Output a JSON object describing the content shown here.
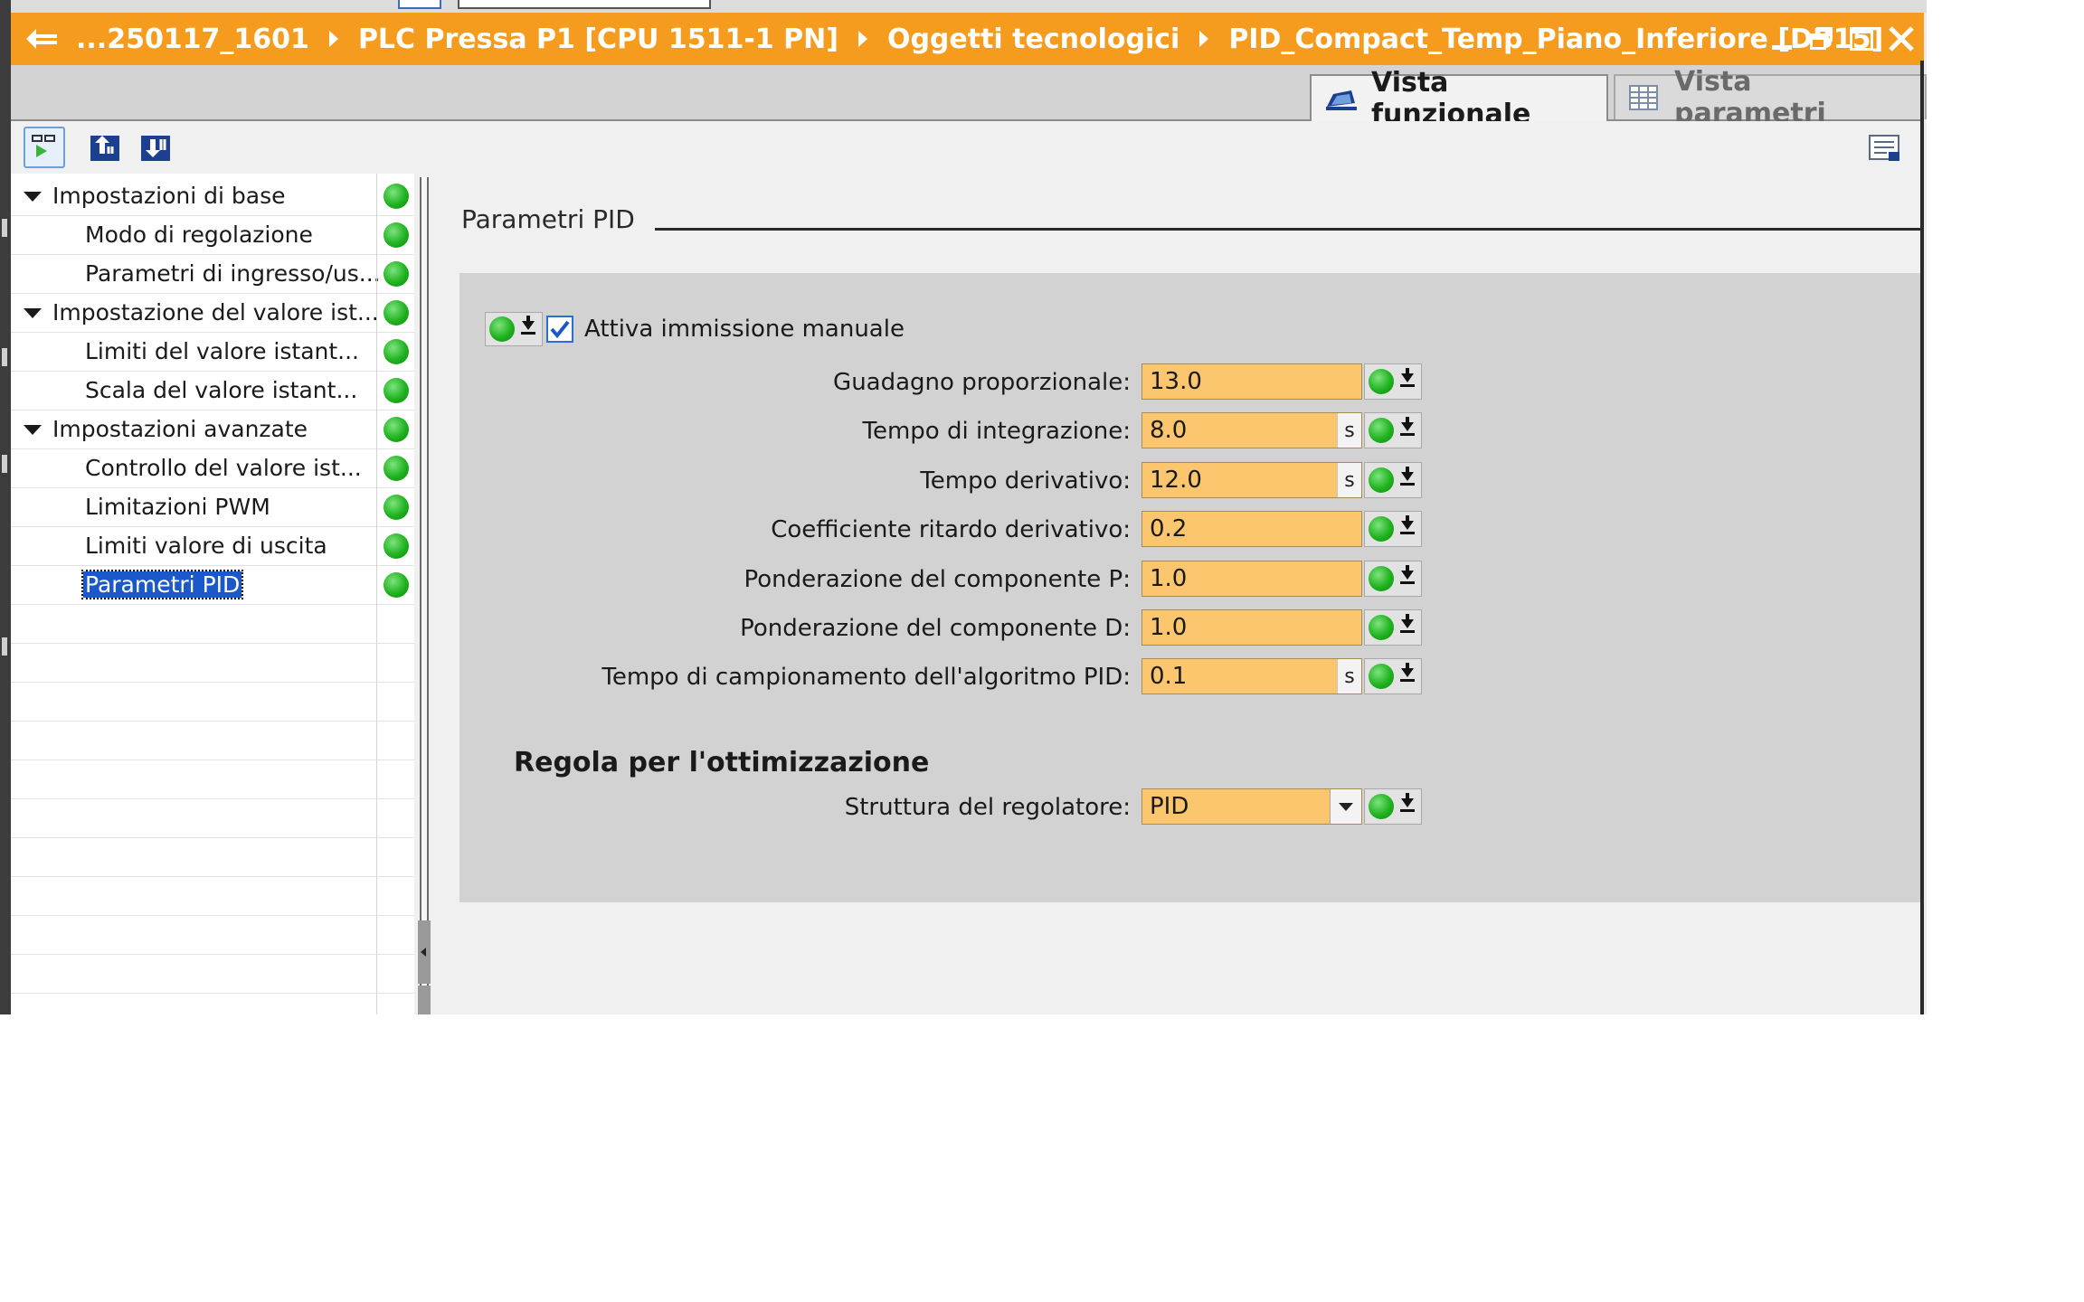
{
  "window": {
    "breadcrumbs": [
      "...250117_1601",
      "PLC Pressa P1 [CPU 1511-1 PN]",
      "Oggetti tecnologici",
      "PID_Compact_Temp_Piano_Inferiore [DB15]"
    ]
  },
  "tabs": {
    "functional": "Vista funzionale",
    "params": "Vista parametri"
  },
  "tree": {
    "items": [
      {
        "label": "Impostazioni di base",
        "level": 0,
        "expanded": true
      },
      {
        "label": "Modo di regolazione",
        "level": 1
      },
      {
        "label": "Parametri di ingresso/us...",
        "level": 1
      },
      {
        "label": "Impostazione del valore ist...",
        "level": 0,
        "expanded": true
      },
      {
        "label": "Limiti del valore istant...",
        "level": 1
      },
      {
        "label": "Scala del valore istant...",
        "level": 1
      },
      {
        "label": "Impostazioni avanzate",
        "level": 0,
        "expanded": true
      },
      {
        "label": "Controllo del valore ist...",
        "level": 1
      },
      {
        "label": "Limitazioni PWM",
        "level": 1
      },
      {
        "label": "Limiti valore di uscita",
        "level": 1
      },
      {
        "label": "Parametri PID",
        "level": 1,
        "selected": true
      }
    ]
  },
  "main": {
    "section_title": "Parametri PID",
    "manual_entry_label": "Attiva immissione manuale",
    "manual_entry_checked": true,
    "params": [
      {
        "label": "Guadagno proporzionale:",
        "value": "13.0",
        "unit": ""
      },
      {
        "label": "Tempo di integrazione:",
        "value": "8.0",
        "unit": "s"
      },
      {
        "label": "Tempo derivativo:",
        "value": "12.0",
        "unit": "s"
      },
      {
        "label": "Coefficiente ritardo derivativo:",
        "value": "0.2",
        "unit": ""
      },
      {
        "label": "Ponderazione del componente P:",
        "value": "1.0",
        "unit": ""
      },
      {
        "label": "Ponderazione del componente D:",
        "value": "1.0",
        "unit": ""
      },
      {
        "label": "Tempo di campionamento dell'algoritmo PID:",
        "value": "0.1",
        "unit": "s"
      }
    ],
    "optimization_title": "Regola per l'ottimizzazione",
    "controller_structure_label": "Struttura del regolatore:",
    "controller_structure_value": "PID"
  },
  "colors": {
    "titlebar": "#f59c1f",
    "input_bg": "#fbc66e",
    "status_ok": "#1fb21f",
    "selection": "#1b58c9"
  }
}
